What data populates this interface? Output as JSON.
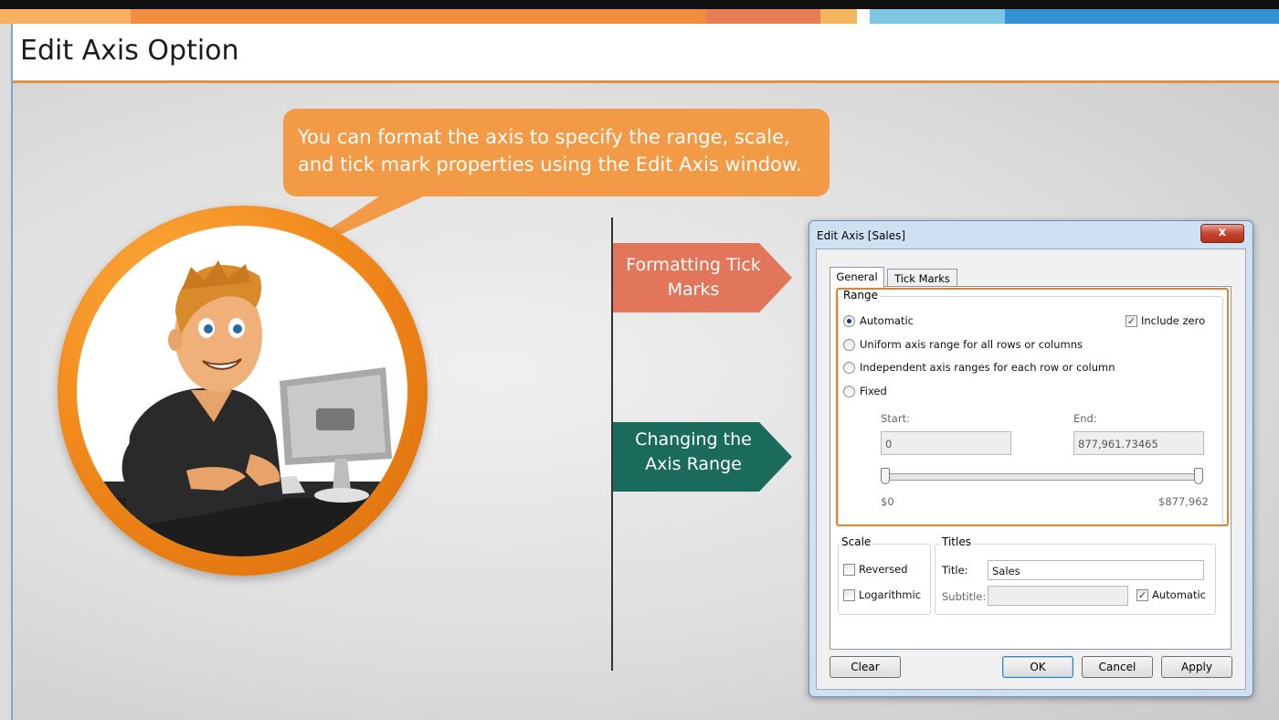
{
  "slide": {
    "title": "Edit Axis Option",
    "speech": "You can format the axis to specify the range, scale, and tick mark properties using the Edit Axis window.",
    "stripe_colors": [
      "#f6a75a",
      "#ee8b3a",
      "#e77a52",
      "#f3b45b",
      "#ffffff",
      "#79c3e0",
      "#2f8fd0"
    ]
  },
  "callouts": {
    "formatting": {
      "label": "Formatting Tick Marks",
      "color": "#e1765a"
    },
    "changing": {
      "label": "Changing the Axis Range",
      "color": "#1a6b5c"
    }
  },
  "dialog": {
    "title": "Edit Axis [Sales]",
    "close_glyph": "x",
    "tabs": [
      {
        "label": "General"
      },
      {
        "label": "Tick Marks"
      }
    ],
    "range": {
      "title": "Range",
      "options": [
        {
          "label": "Automatic",
          "selected": true
        },
        {
          "label": "Uniform axis range for all rows or columns",
          "selected": false
        },
        {
          "label": "Independent axis ranges for each row or column",
          "selected": false
        },
        {
          "label": "Fixed",
          "selected": false
        }
      ],
      "include_zero": {
        "label": "Include zero",
        "checked": true
      },
      "start_label": "Start:",
      "end_label": "End:",
      "start_value": "0",
      "end_value": "877,961.73465",
      "slider_min": "$0",
      "slider_max": "$877,962"
    },
    "scale": {
      "title": "Scale",
      "reversed": {
        "label": "Reversed",
        "checked": false
      },
      "logarithmic": {
        "label": "Logarithmic",
        "checked": false
      }
    },
    "titles": {
      "title": "Titles",
      "title_label": "Title:",
      "title_value": "Sales",
      "subtitle_label": "Subtitle:",
      "subtitle_value": "",
      "automatic": {
        "label": "Automatic",
        "checked": true
      }
    },
    "buttons": {
      "clear": "Clear",
      "ok": "OK",
      "cancel": "Cancel",
      "apply": "Apply"
    }
  }
}
